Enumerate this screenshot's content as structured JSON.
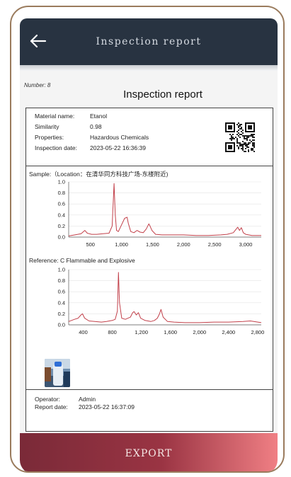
{
  "header": {
    "title": "Inspection report",
    "back_icon": "arrow-left-icon"
  },
  "report": {
    "number_label": "Number: 8",
    "title": "Inspection report",
    "info": [
      {
        "key": "Material name:",
        "value": "Etanol"
      },
      {
        "key": "Similarity",
        "value": "0.98"
      },
      {
        "key": "Properties:",
        "value": "Hazardous Chemicals"
      },
      {
        "key": "Inspection date:",
        "value": "2023-05-22 16:36:39"
      }
    ],
    "sample_label": "Sample:（Location：在清华同方科技广场-东楼附近)",
    "reference_label": "Reference: C Flammable and Explosive",
    "operator_key": "Operator:",
    "operator_value": "Admin",
    "report_date_key": "Report date:",
    "report_date_value": "2023-05-22 16:37:09"
  },
  "chart_data": [
    {
      "type": "line",
      "title": "",
      "xlabel": "",
      "ylabel": "",
      "xlim": [
        150,
        3250
      ],
      "ylim": [
        0,
        1.0
      ],
      "x_ticks": [
        "500",
        "1,000",
        "1,500",
        "2,000",
        "2,500",
        "3,000"
      ],
      "y_ticks": [
        "0.0",
        "0.2",
        "0.4",
        "0.6",
        "0.8",
        "1.0"
      ],
      "series": [
        {
          "x": [
            150,
            250,
            350,
            410,
            450,
            520,
            600,
            700,
            800,
            850,
            880,
            900,
            920,
            950,
            1000,
            1050,
            1090,
            1110,
            1150,
            1200,
            1250,
            1300,
            1350,
            1400,
            1440,
            1460,
            1490,
            1550,
            1650,
            1800,
            2000,
            2200,
            2400,
            2600,
            2700,
            2800,
            2850,
            2870,
            2900,
            2930,
            2960,
            3000,
            3100,
            3250
          ],
          "y": [
            0.02,
            0.04,
            0.06,
            0.12,
            0.07,
            0.05,
            0.05,
            0.06,
            0.07,
            0.2,
            0.97,
            0.4,
            0.12,
            0.1,
            0.22,
            0.34,
            0.36,
            0.25,
            0.1,
            0.08,
            0.12,
            0.09,
            0.08,
            0.15,
            0.24,
            0.2,
            0.12,
            0.05,
            0.04,
            0.04,
            0.04,
            0.03,
            0.03,
            0.04,
            0.05,
            0.08,
            0.15,
            0.18,
            0.12,
            0.17,
            0.08,
            0.05,
            0.03,
            0.03
          ]
        }
      ]
    },
    {
      "type": "line",
      "title": "",
      "xlabel": "",
      "ylabel": "",
      "xlim": [
        200,
        2850
      ],
      "ylim": [
        0,
        1.0
      ],
      "x_ticks": [
        "400",
        "800",
        "1,200",
        "1,600",
        "2,000",
        "2,400",
        "2,800"
      ],
      "y_ticks": [
        "0.0",
        "0.2",
        "0.4",
        "0.6",
        "0.8",
        "1.0"
      ],
      "series": [
        {
          "x": [
            200,
            280,
            330,
            370,
            390,
            420,
            480,
            560,
            650,
            720,
            760,
            800,
            840,
            870,
            885,
            900,
            930,
            980,
            1050,
            1080,
            1100,
            1130,
            1160,
            1190,
            1250,
            1330,
            1380,
            1420,
            1450,
            1470,
            1500,
            1560,
            1650,
            1800,
            2000,
            2200,
            2400,
            2600,
            2700,
            2850
          ],
          "y": [
            0.06,
            0.1,
            0.12,
            0.18,
            0.2,
            0.12,
            0.07,
            0.06,
            0.05,
            0.06,
            0.07,
            0.08,
            0.1,
            0.25,
            0.95,
            0.4,
            0.12,
            0.1,
            0.14,
            0.22,
            0.24,
            0.18,
            0.22,
            0.12,
            0.08,
            0.06,
            0.08,
            0.12,
            0.2,
            0.28,
            0.14,
            0.06,
            0.05,
            0.04,
            0.04,
            0.05,
            0.05,
            0.06,
            0.07,
            0.04
          ]
        }
      ]
    }
  ]
}
